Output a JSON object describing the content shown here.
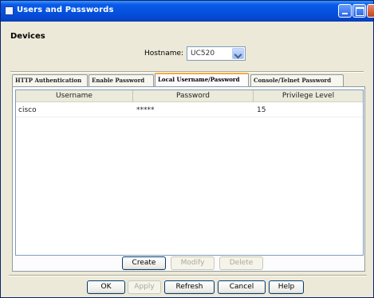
{
  "window": {
    "title": "Users and Passwords"
  },
  "devices": {
    "section_title": "Devices",
    "hostname_label": "Hostname:",
    "hostname_value": "UC520"
  },
  "tabs": [
    {
      "label": "HTTP Authentication",
      "active": false
    },
    {
      "label": "Enable Password",
      "active": false
    },
    {
      "label": "Local Username/Password",
      "active": true
    },
    {
      "label": "Console/Telnet Password",
      "active": false
    }
  ],
  "table": {
    "columns": [
      "Username",
      "Password",
      "Privilege Level"
    ],
    "rows": [
      {
        "username": "cisco",
        "password": "*****",
        "privilege": "15"
      }
    ]
  },
  "table_buttons": {
    "create": "Create",
    "modify": "Modify",
    "delete": "Delete"
  },
  "dialog_buttons": {
    "ok": "OK",
    "apply": "Apply",
    "refresh": "Refresh",
    "cancel": "Cancel",
    "help": "Help"
  },
  "colors": {
    "titlebar": "#0553e0",
    "active_tab_accent": "#f7a842",
    "dialog_bg": "#ece9d8"
  }
}
